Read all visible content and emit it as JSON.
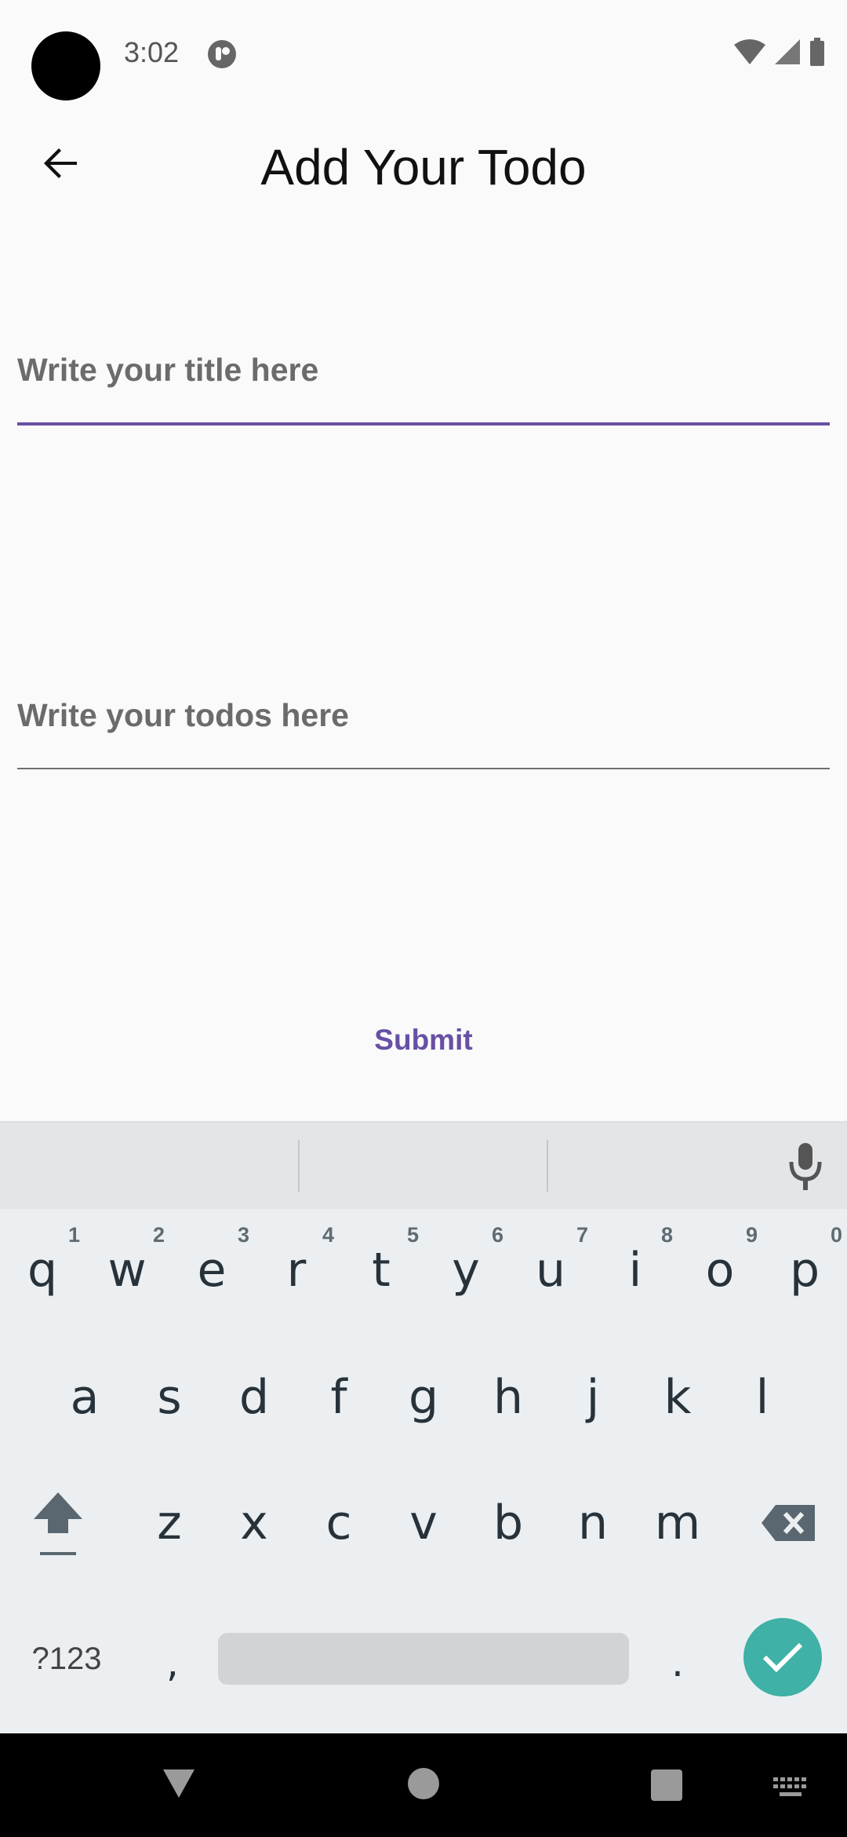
{
  "status_bar": {
    "time": "3:02"
  },
  "app_bar": {
    "title": "Add Your Todo"
  },
  "form": {
    "title_placeholder": "Write your title here",
    "todos_placeholder": "Write your todos here",
    "submit_label": "Submit"
  },
  "keyboard": {
    "row1": [
      {
        "key": "q",
        "hint": "1"
      },
      {
        "key": "w",
        "hint": "2"
      },
      {
        "key": "e",
        "hint": "3"
      },
      {
        "key": "r",
        "hint": "4"
      },
      {
        "key": "t",
        "hint": "5"
      },
      {
        "key": "y",
        "hint": "6"
      },
      {
        "key": "u",
        "hint": "7"
      },
      {
        "key": "i",
        "hint": "8"
      },
      {
        "key": "o",
        "hint": "9"
      },
      {
        "key": "p",
        "hint": "0"
      }
    ],
    "row2": [
      "a",
      "s",
      "d",
      "f",
      "g",
      "h",
      "j",
      "k",
      "l"
    ],
    "row3": [
      "z",
      "x",
      "c",
      "v",
      "b",
      "n",
      "m"
    ],
    "symbols_label": "?123",
    "comma": ",",
    "period": "."
  },
  "colors": {
    "accent": "#6750a4",
    "enter": "#3fb1a6"
  }
}
